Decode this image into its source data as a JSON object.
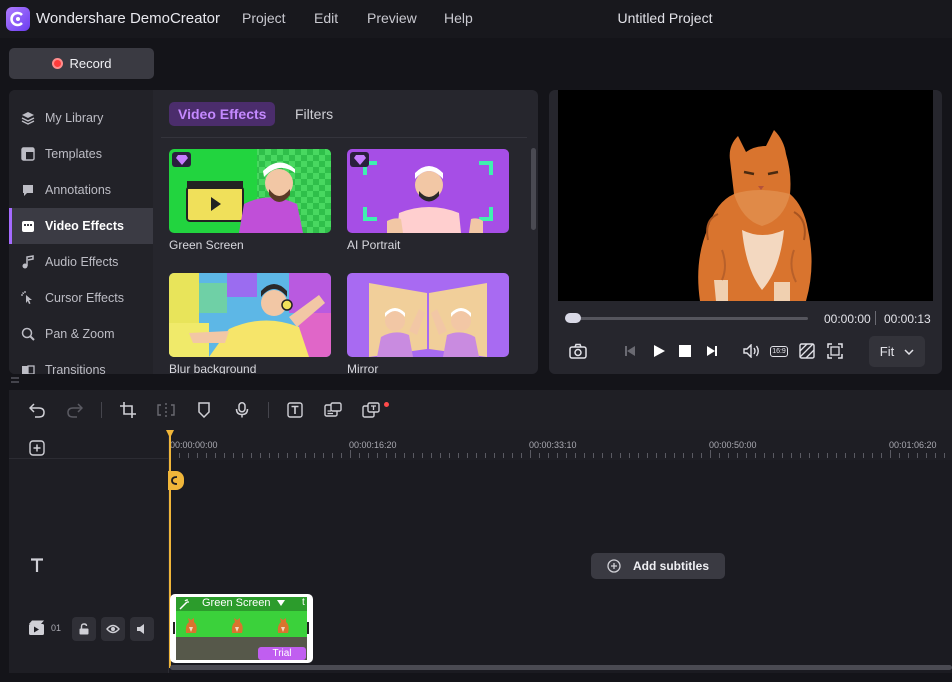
{
  "app": {
    "name": "Wondershare DemoCreator",
    "project_title": "Untitled Project",
    "menu": [
      "Project",
      "Edit",
      "Preview",
      "Help"
    ]
  },
  "record": {
    "label": "Record"
  },
  "sidebar": {
    "items": [
      {
        "label": "My Library",
        "icon": "layers-icon"
      },
      {
        "label": "Templates",
        "icon": "template-icon"
      },
      {
        "label": "Annotations",
        "icon": "annotation-icon"
      },
      {
        "label": "Video Effects",
        "icon": "video-effects-icon",
        "active": true
      },
      {
        "label": "Audio Effects",
        "icon": "audio-effects-icon"
      },
      {
        "label": "Cursor Effects",
        "icon": "cursor-effects-icon"
      },
      {
        "label": "Pan & Zoom",
        "icon": "pan-zoom-icon"
      },
      {
        "label": "Transitions",
        "icon": "transitions-icon"
      }
    ]
  },
  "tabs": [
    {
      "label": "Video Effects",
      "active": true
    },
    {
      "label": "Filters",
      "active": false
    }
  ],
  "effects": [
    {
      "label": "Green Screen",
      "premium": true
    },
    {
      "label": "AI Portrait",
      "premium": true
    },
    {
      "label": "Blur background",
      "premium": false
    },
    {
      "label": "Mirror",
      "premium": false
    }
  ],
  "preview": {
    "current_time": "00:00:00",
    "total_time": "00:00:13",
    "aspect_label": "16:9",
    "fit_label": "Fit",
    "progress": 0
  },
  "timeline": {
    "ruler": [
      "00:00:00:00",
      "00:00:16:20",
      "00:00:33:10",
      "00:00:50:00",
      "00:01:06:20"
    ],
    "track_number": "01",
    "add_subtitles_label": "Add subtitles",
    "clip": {
      "label": "Green Screen",
      "badge": "Trial",
      "trailing": "t"
    }
  },
  "colors": {
    "accent": "#a56bff",
    "record": "#ff3b3b",
    "playhead": "#f0b63a",
    "clip_green": "#3bd13b",
    "trial_badge": "#c05ef0"
  }
}
